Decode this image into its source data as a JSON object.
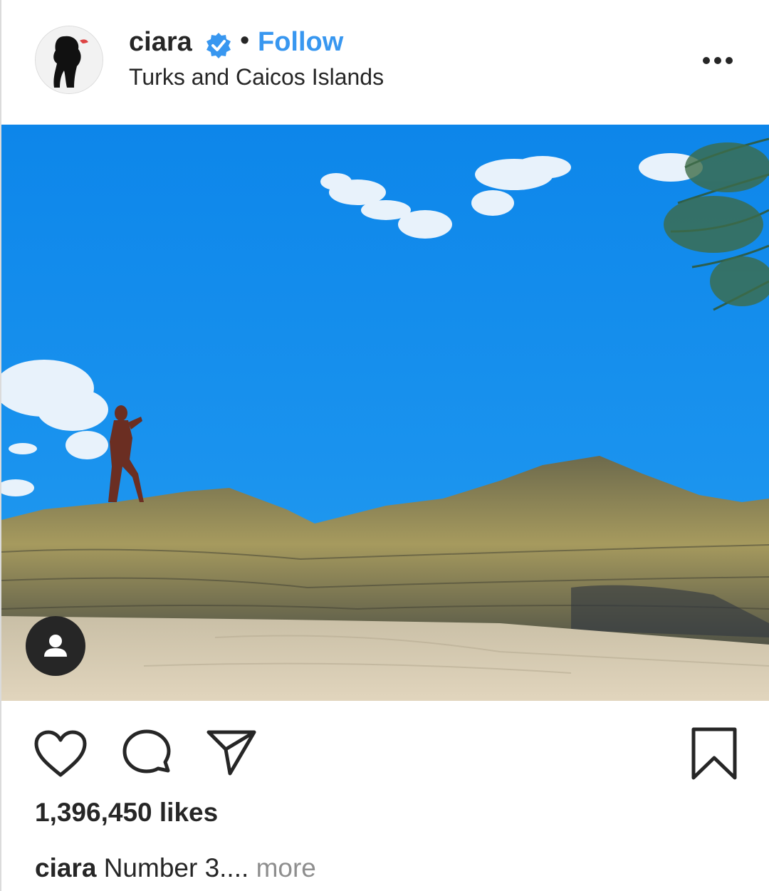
{
  "post": {
    "username": "ciara",
    "separator": "•",
    "follow_label": "Follow",
    "location": "Turks and Caicos Islands",
    "likes_text": "1,396,450 likes",
    "caption_user": "ciara",
    "caption_text": "Number 3....",
    "more_label": "more"
  },
  "icons": {
    "verified": "verified-badge-icon",
    "options": "more-options-icon",
    "tag": "user-tag-icon",
    "like": "heart-icon",
    "comment": "comment-icon",
    "share": "send-icon",
    "save": "bookmark-icon"
  },
  "colors": {
    "accent": "#3897f0",
    "text": "#262626",
    "muted": "#8e8e8e",
    "sky": "#1a90ee"
  }
}
